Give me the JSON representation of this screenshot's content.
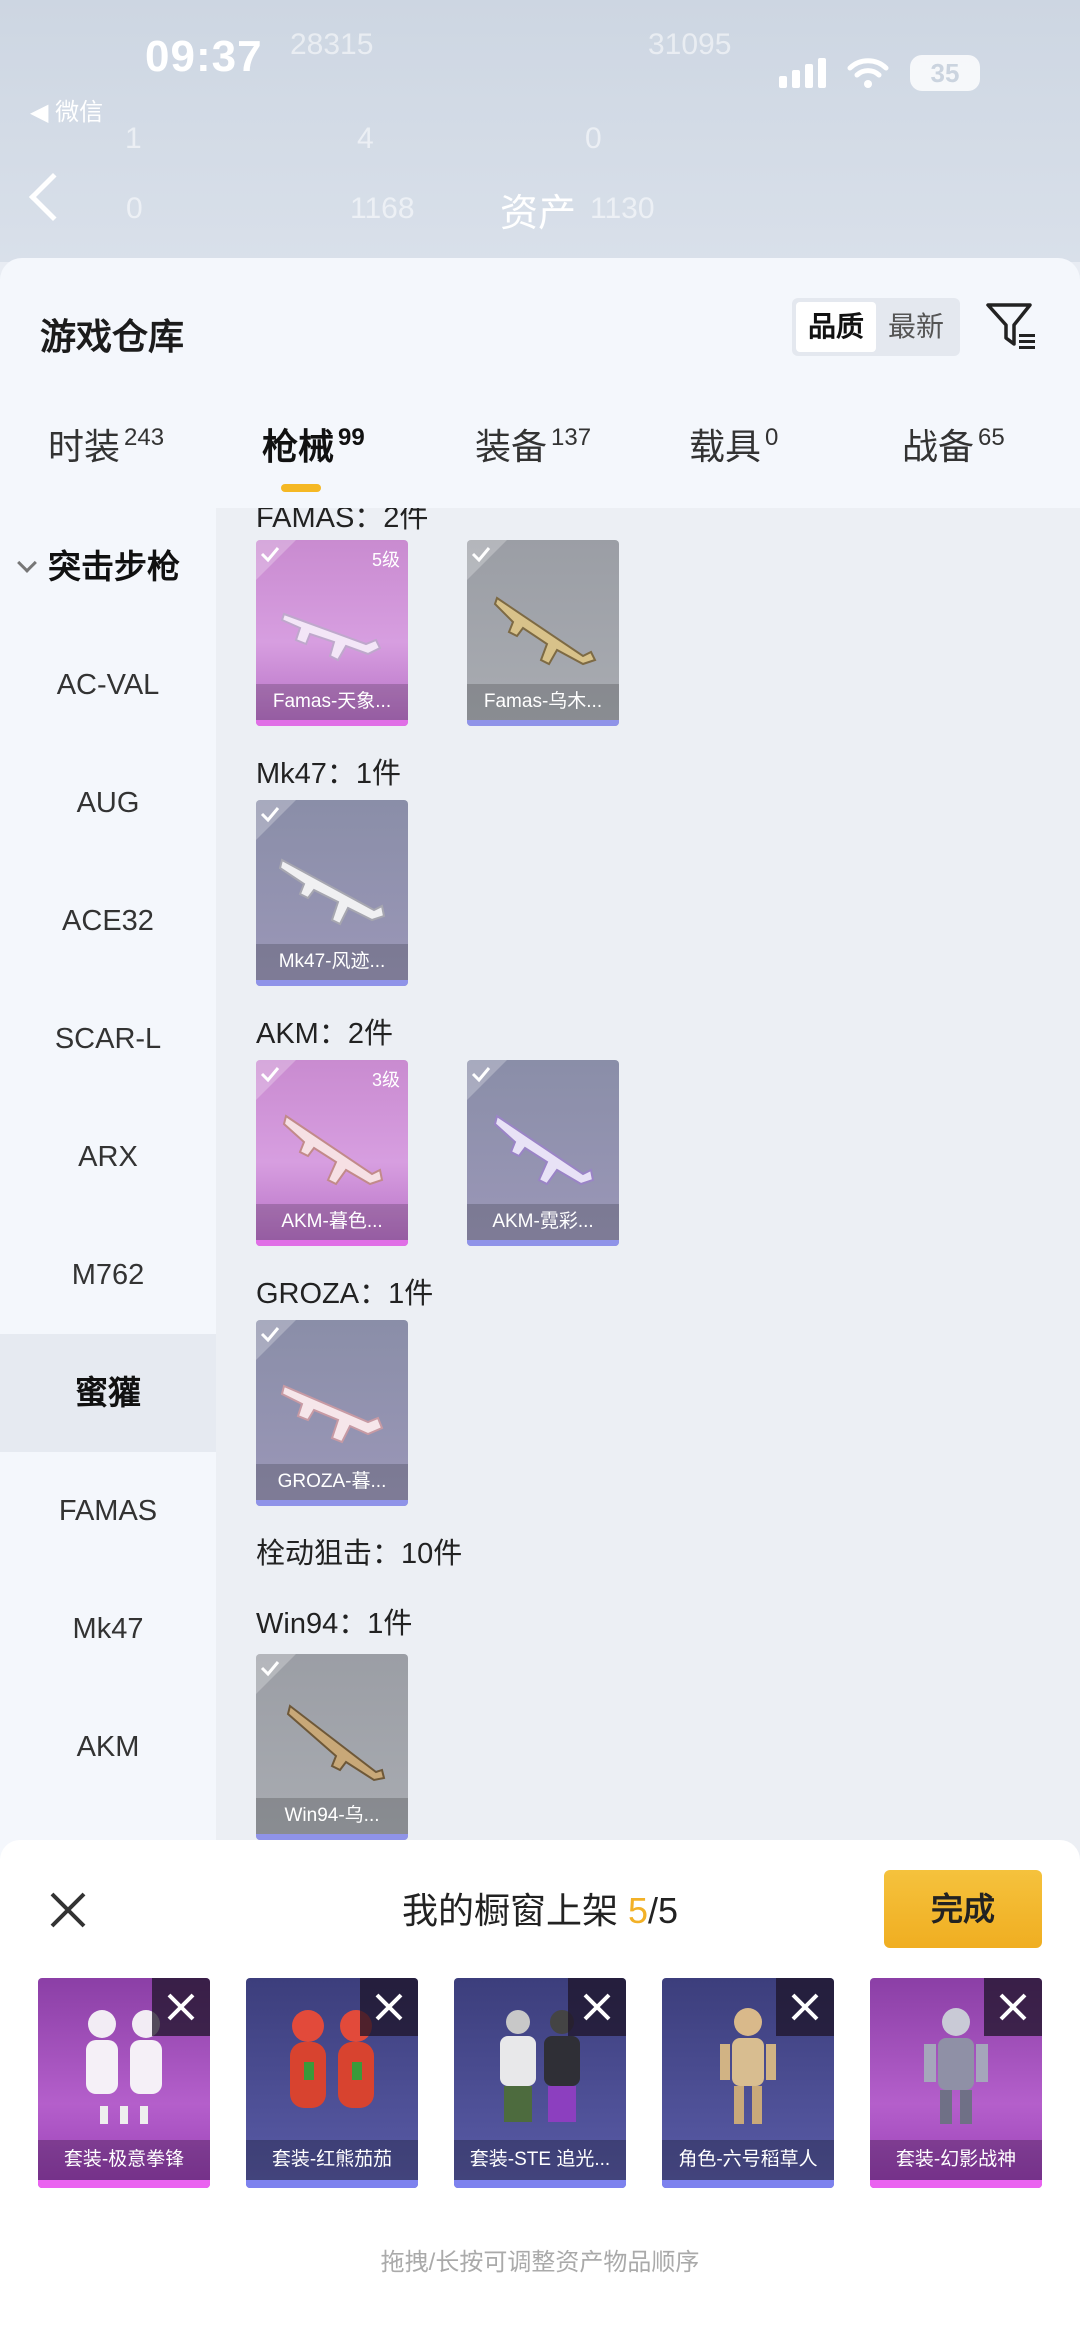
{
  "status": {
    "time": "09:37",
    "back_app": "◀ 微信",
    "battery": "35"
  },
  "page": {
    "title": "资产",
    "ghost_numbers": [
      "28315",
      "31095",
      "1",
      "4",
      "0",
      "0",
      "1168",
      "1130"
    ]
  },
  "warehouse": {
    "title": "游戏仓库",
    "sort": {
      "quality": "品质",
      "newest": "最新"
    },
    "tabs": [
      {
        "label": "时装",
        "count": "243"
      },
      {
        "label": "枪械",
        "count": "99"
      },
      {
        "label": "装备",
        "count": "137"
      },
      {
        "label": "载具",
        "count": "0"
      },
      {
        "label": "战备",
        "count": "65"
      }
    ],
    "categories": [
      "突击步枪",
      "AC-VAL",
      "AUG",
      "ACE32",
      "SCAR-L",
      "ARX",
      "M762",
      "蜜獾",
      "FAMAS",
      "Mk47",
      "AKM"
    ],
    "groups": [
      {
        "label": "FAMAS：2件",
        "items": [
          {
            "name": "Famas-天象...",
            "level": "5级"
          },
          {
            "name": "Famas-乌木..."
          }
        ]
      },
      {
        "label": "Mk47：1件",
        "items": [
          {
            "name": "Mk47-风迹..."
          }
        ]
      },
      {
        "label": "AKM：2件",
        "items": [
          {
            "name": "AKM-暮色...",
            "level": "3级"
          },
          {
            "name": "AKM-霓彩..."
          }
        ]
      },
      {
        "label": "GROZA：1件",
        "items": [
          {
            "name": "GROZA-暮..."
          }
        ]
      },
      {
        "label": "栓动狙击：10件"
      },
      {
        "label": "Win94：1件",
        "items": [
          {
            "name": "Win94-乌..."
          }
        ]
      }
    ]
  },
  "shelf": {
    "title_prefix": "我的橱窗上架 ",
    "count": "5",
    "total": "/5",
    "done": "完成",
    "items": [
      "套装-极意拳锋",
      "套装-红熊茄茄",
      "套装-STE 追光...",
      "角色-六号稻草人",
      "套装-幻影战神"
    ],
    "hint": "拖拽/长按可调整资产物品顺序"
  },
  "colors": {
    "accent": "#f5b824",
    "pink_rarity": "#e06fe6",
    "blue_rarity": "#8f93e8"
  }
}
